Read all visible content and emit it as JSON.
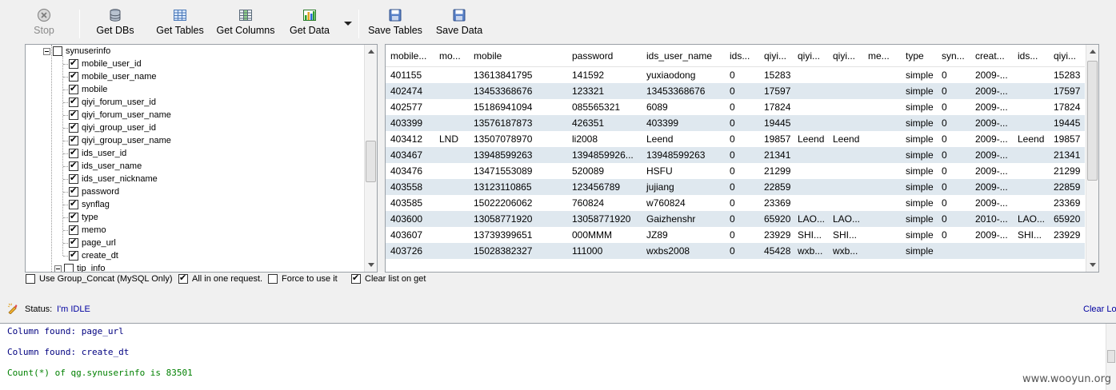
{
  "toolbar": {
    "stop": "Stop",
    "get_dbs": "Get DBs",
    "get_tables": "Get Tables",
    "get_columns": "Get Columns",
    "get_data": "Get Data",
    "save_tables": "Save Tables",
    "save_data": "Save Data"
  },
  "tree": {
    "parent": "synuserinfo",
    "columns": [
      "mobile_user_id",
      "mobile_user_name",
      "mobile",
      "qiyi_forum_user_id",
      "qiyi_forum_user_name",
      "qiyi_group_user_id",
      "qiyi_group_user_name",
      "ids_user_id",
      "ids_user_name",
      "ids_user_nickname",
      "password",
      "synflag",
      "type",
      "memo",
      "page_url",
      "create_dt"
    ],
    "next": "tip_info"
  },
  "options": {
    "group_concat": "Use Group_Concat (MySQL Only)",
    "all_in_one": "All in one request.",
    "force": "Force to use it",
    "clear_list": "Clear list on get"
  },
  "grid": {
    "headers": [
      "mobile...",
      "mo...",
      "mobile",
      "password",
      "ids_user_name",
      "ids...",
      "qiyi...",
      "qiyi...",
      "qiyi...",
      "me...",
      "type",
      "syn...",
      "creat...",
      "ids...",
      "qiyi..."
    ],
    "rows": [
      [
        "401155",
        "",
        "13613841795",
        "141592",
        "yuxiaodong",
        "0",
        "15283",
        "",
        "",
        "",
        "simple",
        "0",
        "2009-...",
        "",
        "15283"
      ],
      [
        "402474",
        "",
        "13453368676",
        "123321",
        "13453368676",
        "0",
        "17597",
        "",
        "",
        "",
        "simple",
        "0",
        "2009-...",
        "",
        "17597"
      ],
      [
        "402577",
        "",
        "15186941094",
        "085565321",
        "6089",
        "0",
        "17824",
        "",
        "",
        "",
        "simple",
        "0",
        "2009-...",
        "",
        "17824"
      ],
      [
        "403399",
        "",
        "13576187873",
        "426351",
        "403399",
        "0",
        "19445",
        "",
        "",
        "",
        "simple",
        "0",
        "2009-...",
        "",
        "19445"
      ],
      [
        "403412",
        "LND",
        "13507078970",
        "li2008",
        "Leend",
        "0",
        "19857",
        "Leend",
        "Leend",
        "",
        "simple",
        "0",
        "2009-...",
        "Leend",
        "19857"
      ],
      [
        "403467",
        "",
        "13948599263",
        "1394859926...",
        "13948599263",
        "0",
        "21341",
        "",
        "",
        "",
        "simple",
        "0",
        "2009-...",
        "",
        "21341"
      ],
      [
        "403476",
        "",
        "13471553089",
        "520089",
        "HSFU",
        "0",
        "21299",
        "",
        "",
        "",
        "simple",
        "0",
        "2009-...",
        "",
        "21299"
      ],
      [
        "403558",
        "",
        "13123110865",
        "123456789",
        "jujiang",
        "0",
        "22859",
        "",
        "",
        "",
        "simple",
        "0",
        "2009-...",
        "",
        "22859"
      ],
      [
        "403585",
        "",
        "15022206062",
        "760824",
        "w760824",
        "0",
        "23369",
        "",
        "",
        "",
        "simple",
        "0",
        "2009-...",
        "",
        "23369"
      ],
      [
        "403600",
        "",
        "13058771920",
        "13058771920",
        "Gaizhenshr",
        "0",
        "65920",
        "LAO...",
        "LAO...",
        "",
        "simple",
        "0",
        "2010-...",
        "LAO...",
        "65920"
      ],
      [
        "403607",
        "",
        "13739399651",
        "000MMM",
        "JZ89",
        "0",
        "23929",
        "SHI...",
        "SHI...",
        "",
        "simple",
        "0",
        "2009-...",
        "SHI...",
        "23929"
      ],
      [
        "403726",
        "",
        "15028382327",
        "111000",
        "wxbs2008",
        "0",
        "45428",
        "wxb...",
        "wxb...",
        "",
        "simple",
        "",
        "",
        "",
        ""
      ]
    ]
  },
  "status": {
    "label": "Status:",
    "text": "I'm IDLE",
    "clear_log": "Clear Log"
  },
  "log": [
    {
      "text": "Column found: page_url",
      "color": "#000080"
    },
    {
      "text": "Column found: create_dt",
      "color": "#000080"
    },
    {
      "text": "Count(*) of qg.synuserinfo is 83501",
      "color": "#008000"
    }
  ],
  "watermark": "www.wooyun.org"
}
